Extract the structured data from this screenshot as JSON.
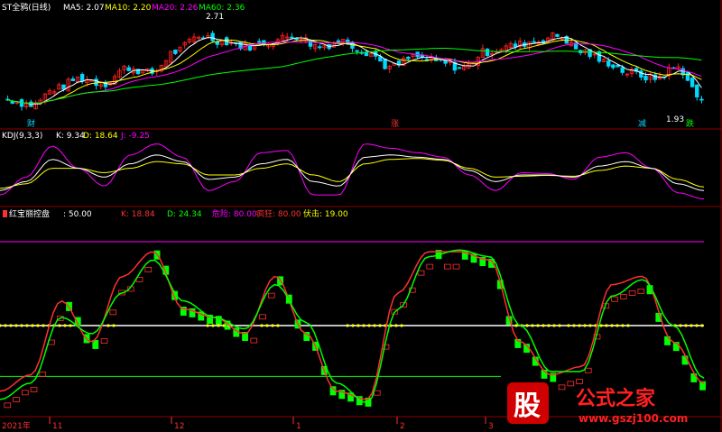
{
  "theme": {
    "bg": "#000000",
    "frame": "#8B0000",
    "up": "#FF2020",
    "down": "#00D8FF",
    "ma5": "#FFFFFF",
    "ma10": "#FFFF00",
    "ma20": "#FF00FF",
    "ma60": "#00FF00",
    "green_bar": "#00FF00",
    "red_bar": "#FF3030",
    "white_line": "#FFFFFF",
    "yellow_dots": "#FFFF00"
  },
  "header1": {
    "title": "ST全鸦(日线)",
    "ma5_label": "MA5: 2.07",
    "ma10_label": "MA10: 2.20",
    "ma20_label": "MA20: 2.26",
    "ma60_label": "MA60: 2.36",
    "high_label": "2.71",
    "low_label": "1.93",
    "markers": [
      {
        "text": "财",
        "color": "#00D8FF"
      },
      {
        "text": "涨",
        "color": "#FF3030"
      },
      {
        "text": "减",
        "color": "#00D8FF"
      },
      {
        "text": "跌",
        "color": "#00FF00"
      }
    ]
  },
  "header2": {
    "title": "KDJ(9,3,3)",
    "k_label": "K: 9.34",
    "d_label": "D: 18.64",
    "j_label": "J: -9.25"
  },
  "header3": {
    "title": "红宝丽控盘",
    "v1": ": 50.00",
    "k_label": "K: 18.84",
    "d_label": "D: 24.34",
    "risk": "危险: 80.00",
    "crazy": "疯狂: 80.00",
    "ambush": "伏击: 19.00"
  },
  "xaxis": {
    "labels": [
      {
        "text": "2021年",
        "at": 0
      },
      {
        "text": "11",
        "at": 55
      },
      {
        "text": "12",
        "at": 190
      },
      {
        "text": "1",
        "at": 325
      },
      {
        "text": "2",
        "at": 440
      },
      {
        "text": "3",
        "at": 538
      }
    ]
  },
  "watermark": {
    "big": "股",
    "text": "公式之家",
    "url": "www.gszj100.com"
  },
  "chart_data": [
    {
      "type": "candlestick",
      "panel": "price",
      "y_range": [
        1.85,
        2.8
      ],
      "series_names": [
        "MA5",
        "MA10",
        "MA20",
        "MA60"
      ],
      "close_anchor": [
        2.0,
        1.95,
        2.1,
        2.2,
        2.15,
        2.3,
        2.25,
        2.45,
        2.6,
        2.55,
        2.5,
        2.55,
        2.6,
        2.5,
        2.55,
        2.45,
        2.3,
        2.4,
        2.35,
        2.3,
        2.45,
        2.5,
        2.55,
        2.6,
        2.45,
        2.35,
        2.25,
        2.2,
        2.3,
        2.0
      ]
    },
    {
      "type": "line",
      "panel": "KDJ",
      "y_range": [
        -20,
        120
      ],
      "series_names": [
        "K",
        "D",
        "J"
      ],
      "k_anchor": [
        10,
        30,
        80,
        60,
        40,
        70,
        90,
        75,
        35,
        40,
        70,
        80,
        30,
        20,
        85,
        90,
        85,
        80,
        55,
        30,
        45,
        45,
        40,
        65,
        75,
        60,
        25,
        10
      ],
      "d_anchor": [
        15,
        25,
        60,
        60,
        50,
        60,
        75,
        70,
        45,
        45,
        60,
        70,
        45,
        30,
        70,
        80,
        82,
        78,
        60,
        40,
        42,
        44,
        42,
        55,
        65,
        60,
        35,
        18
      ],
      "j_anchor": [
        0,
        40,
        110,
        60,
        20,
        90,
        115,
        85,
        10,
        30,
        95,
        100,
        0,
        0,
        115,
        105,
        95,
        85,
        45,
        10,
        50,
        48,
        35,
        85,
        95,
        60,
        5,
        -9
      ]
    },
    {
      "type": "line",
      "panel": "红宝丽控盘",
      "y_range": [
        0,
        100
      ],
      "levels": {
        "risk": 80,
        "mid": 50,
        "ambush": 19
      },
      "red_line": [
        10,
        20,
        65,
        40,
        80,
        95,
        60,
        55,
        45,
        80,
        45,
        10,
        5,
        70,
        95,
        95,
        90,
        40,
        20,
        25,
        75,
        80,
        40,
        15
      ],
      "green_line": [
        5,
        15,
        55,
        45,
        70,
        90,
        65,
        55,
        48,
        75,
        52,
        15,
        3,
        60,
        92,
        96,
        92,
        50,
        22,
        22,
        68,
        78,
        50,
        18
      ]
    }
  ]
}
